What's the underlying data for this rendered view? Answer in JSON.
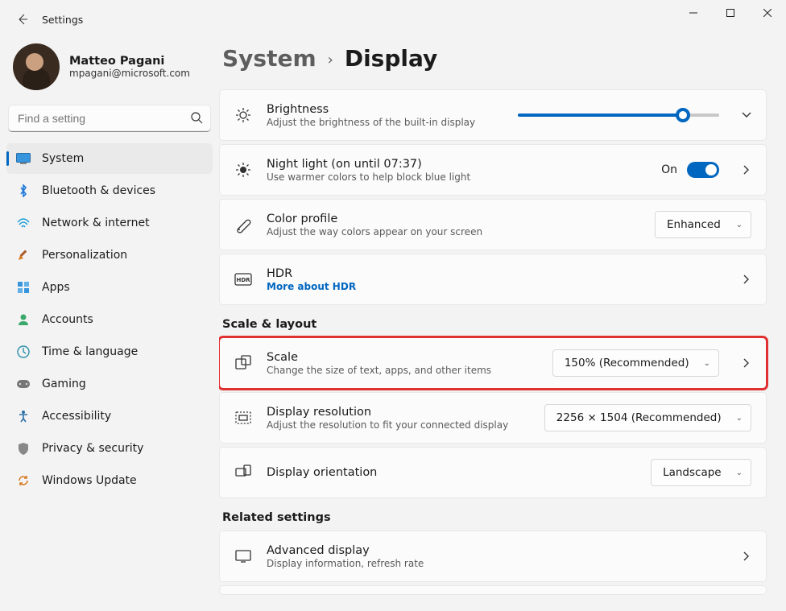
{
  "window": {
    "title": "Settings"
  },
  "profile": {
    "name": "Matteo Pagani",
    "email": "mpagani@microsoft.com"
  },
  "search": {
    "placeholder": "Find a setting"
  },
  "nav": {
    "items": [
      {
        "label": "System"
      },
      {
        "label": "Bluetooth & devices"
      },
      {
        "label": "Network & internet"
      },
      {
        "label": "Personalization"
      },
      {
        "label": "Apps"
      },
      {
        "label": "Accounts"
      },
      {
        "label": "Time & language"
      },
      {
        "label": "Gaming"
      },
      {
        "label": "Accessibility"
      },
      {
        "label": "Privacy & security"
      },
      {
        "label": "Windows Update"
      }
    ]
  },
  "breadcrumb": {
    "level1": "System",
    "level2": "Display"
  },
  "sections": {
    "scale_layout": "Scale & layout",
    "related": "Related settings"
  },
  "cards": {
    "brightness": {
      "title": "Brightness",
      "sub": "Adjust the brightness of the built-in display",
      "value_percent": 82
    },
    "nightlight": {
      "title": "Night light (on until 07:37)",
      "sub": "Use warmer colors to help block blue light",
      "toggle_state": "On"
    },
    "colorprofile": {
      "title": "Color profile",
      "sub": "Adjust the way colors appear on your screen",
      "dropdown_value": "Enhanced"
    },
    "hdr": {
      "title": "HDR",
      "link": "More about HDR"
    },
    "scale": {
      "title": "Scale",
      "sub": "Change the size of text, apps, and other items",
      "dropdown_value": "150% (Recommended)"
    },
    "resolution": {
      "title": "Display resolution",
      "sub": "Adjust the resolution to fit your connected display",
      "dropdown_value": "2256 × 1504 (Recommended)"
    },
    "orientation": {
      "title": "Display orientation",
      "dropdown_value": "Landscape"
    },
    "advanced": {
      "title": "Advanced display",
      "sub": "Display information, refresh rate"
    }
  }
}
